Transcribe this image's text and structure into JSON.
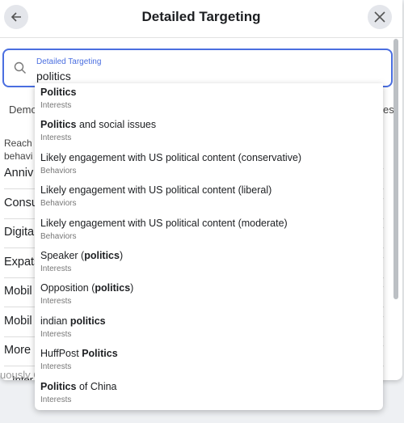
{
  "header": {
    "title": "Detailed Targeting",
    "back_icon": "arrow-left-icon",
    "close_icon": "close-icon"
  },
  "search": {
    "label": "Detailed Targeting",
    "value": "politics",
    "icon": "search-icon",
    "accent": "#4a6ee0"
  },
  "background": {
    "tab_left": "Demo",
    "tab_right": "es",
    "desc_line1": "Reach p",
    "desc_line2": "behavi",
    "rows": [
      "Anniv",
      "Consu",
      "Digita",
      "Expats",
      "Mobil",
      "Mobil",
      "More",
      "Inter"
    ],
    "footer": "uously C"
  },
  "dropdown": {
    "items": [
      {
        "pre": "",
        "bold": "Politics",
        "post": "",
        "category": "Interests"
      },
      {
        "pre": "",
        "bold": "Politics",
        "post": " and social issues",
        "category": "Interests"
      },
      {
        "pre": "Likely engagement with US political content (conservative)",
        "bold": "",
        "post": "",
        "category": "Behaviors"
      },
      {
        "pre": "Likely engagement with US political content (liberal)",
        "bold": "",
        "post": "",
        "category": "Behaviors"
      },
      {
        "pre": "Likely engagement with US political content (moderate)",
        "bold": "",
        "post": "",
        "category": "Behaviors"
      },
      {
        "pre": "Speaker (",
        "bold": "politics",
        "post": ")",
        "category": "Interests"
      },
      {
        "pre": "Opposition (",
        "bold": "politics",
        "post": ")",
        "category": "Interests"
      },
      {
        "pre": "indian ",
        "bold": "politics",
        "post": "",
        "category": "Interests"
      },
      {
        "pre": "HuffPost ",
        "bold": "Politics",
        "post": "",
        "category": "Interests"
      },
      {
        "pre": "",
        "bold": "Politics",
        "post": " of China",
        "category": "Interests"
      }
    ]
  }
}
